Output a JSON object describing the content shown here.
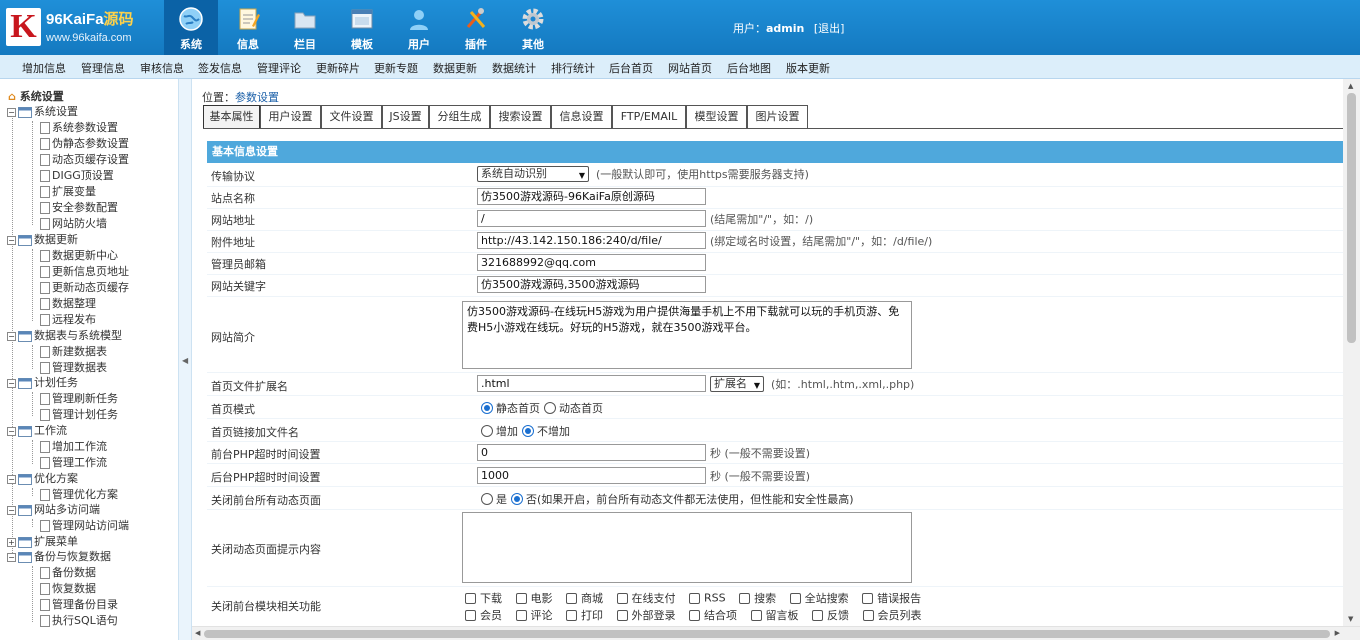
{
  "logo": {
    "letter": "K",
    "brand_a": "96KaiFa",
    "brand_b": "源码",
    "url": "www.96kaifa.com"
  },
  "nav": [
    {
      "label": "系统",
      "icon": "globe-icon",
      "active": true
    },
    {
      "label": "信息",
      "icon": "notepad-icon"
    },
    {
      "label": "栏目",
      "icon": "folder-icon"
    },
    {
      "label": "模板",
      "icon": "window-icon"
    },
    {
      "label": "用户",
      "icon": "user-icon"
    },
    {
      "label": "插件",
      "icon": "tools-icon"
    },
    {
      "label": "其他",
      "icon": "gear-icon"
    }
  ],
  "user": {
    "prefix": "用户：",
    "name": "admin",
    "logout": "[退出]"
  },
  "subnav": [
    "增加信息",
    "管理信息",
    "审核信息",
    "签发信息",
    "管理评论",
    "更新碎片",
    "更新专题",
    "数据更新",
    "数据统计",
    "排行统计",
    "后台首页",
    "网站首页",
    "后台地图",
    "版本更新"
  ],
  "tree": {
    "root": "系统设置",
    "groups": [
      {
        "label": "系统设置",
        "items": [
          "系统参数设置",
          "伪静态参数设置",
          "动态页缓存设置",
          "DIGG顶设置",
          "扩展变量",
          "安全参数配置",
          "网站防火墙"
        ]
      },
      {
        "label": "数据更新",
        "items": [
          "数据更新中心",
          "更新信息页地址",
          "更新动态页缓存",
          "数据整理",
          "远程发布"
        ]
      },
      {
        "label": "数据表与系统模型",
        "items": [
          "新建数据表",
          "管理数据表"
        ]
      },
      {
        "label": "计划任务",
        "items": [
          "管理刷新任务",
          "管理计划任务"
        ]
      },
      {
        "label": "工作流",
        "items": [
          "增加工作流",
          "管理工作流"
        ]
      },
      {
        "label": "优化方案",
        "items": [
          "管理优化方案"
        ]
      },
      {
        "label": "网站多访问端",
        "items": [
          "管理网站访问端"
        ]
      },
      {
        "label": "扩展菜单",
        "items": [],
        "collapsed": true
      },
      {
        "label": "备份与恢复数据",
        "items": [
          "备份数据",
          "恢复数据",
          "管理备份目录",
          "执行SQL语句"
        ]
      }
    ]
  },
  "location": {
    "prefix": "位置：",
    "value": "参数设置"
  },
  "tabs": [
    "基本属性",
    "用户设置",
    "文件设置",
    "JS设置",
    "分组生成",
    "搜索设置",
    "信息设置",
    "FTP/EMAIL",
    "模型设置",
    "图片设置"
  ],
  "section_title": "基本信息设置",
  "form": {
    "protocol": {
      "label": "传输协议",
      "value": "系统自动识别",
      "hint": "(一般默认即可，使用https需要服务器支持)"
    },
    "sitename": {
      "label": "站点名称",
      "value": "仿3500游戏源码-96KaiFa原创源码"
    },
    "siteurl": {
      "label": "网站地址",
      "value": "/",
      "hint": "(结尾需加\"/\"，如：/)"
    },
    "fileurl": {
      "label": "附件地址",
      "value": "http://43.142.150.186:240/d/file/",
      "hint": "(绑定域名时设置，结尾需加\"/\"，如：/d/file/)"
    },
    "email": {
      "label": "管理员邮箱",
      "value": "321688992@qq.com"
    },
    "keywords": {
      "label": "网站关键字",
      "value": "仿3500游戏源码,3500游戏源码"
    },
    "intro": {
      "label": "网站简介",
      "value": "仿3500游戏源码-在线玩H5游戏为用户提供海量手机上不用下载就可以玩的手机页游、免费H5小游戏在线玩。好玩的H5游戏，就在3500游戏平台。"
    },
    "indexext": {
      "label": "首页文件扩展名",
      "value": ".html",
      "select": "扩展名",
      "hint": "(如：.html,.htm,.xml,.php)"
    },
    "indexmode": {
      "label": "首页模式",
      "opt1": "静态首页",
      "opt2": "动态首页"
    },
    "indexappend": {
      "label": "首页链接加文件名",
      "opt1": "增加",
      "opt2": "不增加"
    },
    "fronttimeout": {
      "label": "前台PHP超时时间设置",
      "value": "0",
      "hint": "秒 (一般不需要设置)"
    },
    "backtimeout": {
      "label": "后台PHP超时时间设置",
      "value": "1000",
      "hint": "秒 (一般不需要设置)"
    },
    "closedyn": {
      "label": "关闭前台所有动态页面",
      "opt1": "是",
      "opt2": "否(如果开启，前台所有动态文件都无法使用，但性能和安全性最高)"
    },
    "closetip": {
      "label": "关闭动态页面提示内容",
      "value": ""
    },
    "closemods": {
      "label": "关闭前台模块相关功能",
      "row1": [
        "下载",
        "电影",
        "商城",
        "在线支付",
        "RSS",
        "搜索",
        "全站搜索",
        "错误报告"
      ],
      "row2": [
        "会员",
        "评论",
        "打印",
        "外部登录",
        "结合项",
        "留言板",
        "反馈",
        "会员列表"
      ]
    }
  }
}
